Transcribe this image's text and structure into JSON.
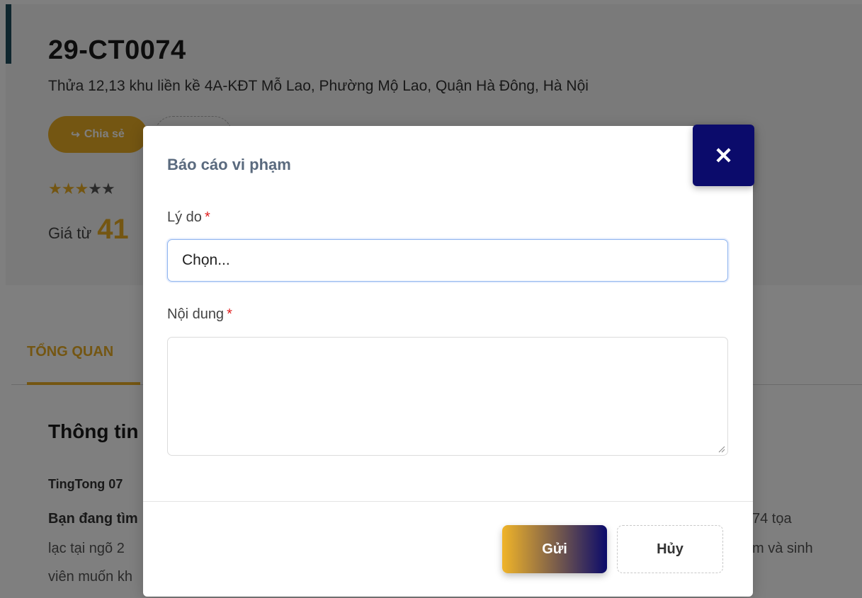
{
  "listing": {
    "code": "29-CT0074",
    "address": "Thửa 12,13 khu liền kề 4A-KĐT Mỗ Lao, Phường Mộ Lao, Quận Hà Đông, Hà Nội",
    "share_label": "Chia sẻ",
    "rating": {
      "value": 3,
      "max": 5
    },
    "price_label": "Giá từ",
    "price_value": "41"
  },
  "tabs": {
    "overview_label": "TỔNG QUAN"
  },
  "content": {
    "section_title": "Thông tin",
    "agent_name": "TingTong 07",
    "desc_line1": "Bạn đang tìm",
    "desc_line2": "lạc tại ngõ 2",
    "desc_line3": "viên muốn kh",
    "desc_right1": "74 tọa",
    "desc_right2": "m và sinh"
  },
  "modal": {
    "title": "Báo cáo vi phạm",
    "close_icon": "close-icon",
    "reason_label": "Lý do",
    "reason_value": "Chọn...",
    "content_label": "Nội dung",
    "required_mark": "*",
    "content_value": "",
    "send_label": "Gửi",
    "cancel_label": "Hủy"
  },
  "colors": {
    "accent": "#e9ad25",
    "navy": "#0b0b6b",
    "required": "#e02020"
  }
}
